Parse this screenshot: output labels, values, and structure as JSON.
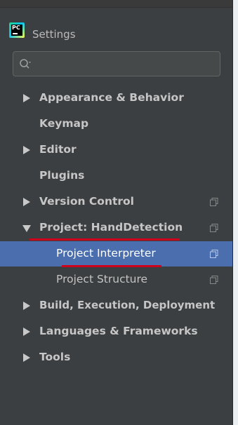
{
  "window": {
    "title": "Settings",
    "app_icon_text": "PC"
  },
  "search": {
    "value": "",
    "placeholder": ""
  },
  "tree": [
    {
      "label": "Appearance & Behavior",
      "arrow": "right",
      "bold": true,
      "project_icon": false
    },
    {
      "label": "Keymap",
      "arrow": "none",
      "bold": true,
      "project_icon": false
    },
    {
      "label": "Editor",
      "arrow": "right",
      "bold": true,
      "project_icon": false
    },
    {
      "label": "Plugins",
      "arrow": "none",
      "bold": true,
      "project_icon": false
    },
    {
      "label": "Version Control",
      "arrow": "right",
      "bold": true,
      "project_icon": true
    },
    {
      "label": "Project: HandDetection",
      "arrow": "down",
      "bold": true,
      "project_icon": true,
      "annotated": true
    },
    {
      "label": "Project Interpreter",
      "arrow": "none",
      "bold": false,
      "project_icon": true,
      "selected": true,
      "annotated": true
    },
    {
      "label": "Project Structure",
      "arrow": "none",
      "bold": false,
      "project_icon": true
    },
    {
      "label": "Build, Execution, Deployment",
      "arrow": "right",
      "bold": true,
      "project_icon": false
    },
    {
      "label": "Languages & Frameworks",
      "arrow": "right",
      "bold": true,
      "project_icon": false
    },
    {
      "label": "Tools",
      "arrow": "right",
      "bold": true,
      "project_icon": false
    }
  ],
  "colors": {
    "background": "#3c3f41",
    "selection": "#4b6eaf",
    "annotation_red": "#d0011b",
    "text": "#bbbbbb"
  }
}
